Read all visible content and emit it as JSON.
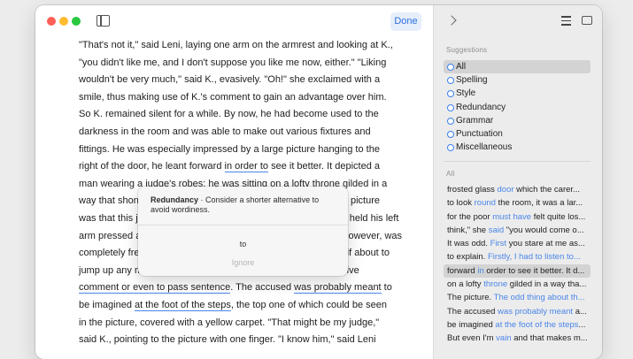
{
  "toolbar": {
    "done_label": "Done"
  },
  "document": {
    "lines": [
      [
        {
          "t": "\"That's not it,\" said Leni, laying one arm on the armrest and looking at K.,"
        }
      ],
      [
        {
          "t": "\"you didn't like me, and I don't suppose you like me now, either.\" \"Liking"
        }
      ],
      [
        {
          "t": "wouldn't be very much,\" said K., evasively. \"Oh!\" she exclaimed with a"
        }
      ],
      [
        {
          "t": "smile, thus making use of K.'s comment to gain an advantage over him."
        }
      ],
      [
        {
          "t": "So K. remained silent for a while. By now, he had become used to the"
        }
      ],
      [
        {
          "t": "darkness in the room and was able to make out various fixtures and"
        }
      ],
      [
        {
          "t": "fittings. He was especially impressed by a large picture hanging to the"
        }
      ],
      [
        {
          "t": "right of the door, he leant forward "
        },
        {
          "t": "in order to",
          "u": "sel"
        },
        {
          "t": " see it better. It depicted a"
        }
      ],
      [
        {
          "t": "man wearing a judge's robes; he was sitting on a lofty throne gilded in a"
        }
      ],
      [
        {
          "t": "way that shone out of the picture. What was unusual about the picture"
        }
      ],
      [
        {
          "t": "was that this judge was not sitting there in dignified repose; he held his left"
        }
      ],
      [
        {
          "t": "arm pressed against the back and the armrest, the right arm, however, was"
        }
      ],
      [
        {
          "t": "completely free and gripped only the armrest with its hand, as if about to"
        }
      ],
      [
        {
          "t": "jump up any moment in a violent outburst and to make a decisive"
        }
      ],
      [
        {
          "t": "comment or even to pass sentence",
          "u": "u"
        },
        {
          "t": ". The accused "
        },
        {
          "t": "was probably meant",
          "u": "u"
        },
        {
          "t": " to"
        }
      ],
      [
        {
          "t": "be imagined "
        },
        {
          "t": "at the foot of the steps",
          "u": "u"
        },
        {
          "t": ", the top one of which could be seen"
        }
      ],
      [
        {
          "t": "in the picture, covered with a yellow carpet. \"That might be my judge,\""
        }
      ],
      [
        {
          "t": "said K., pointing to the picture with one finger. \"I know him,\" said Leni"
        }
      ]
    ]
  },
  "popover": {
    "title": "Redundancy",
    "description": " · Consider a shorter alternative to avoid wordiness.",
    "suggestion": "to",
    "ignore_label": "Ignore"
  },
  "sidebar": {
    "suggestions_heading": "Suggestions",
    "categories": [
      "All",
      "Spelling",
      "Style",
      "Redundancy",
      "Grammar",
      "Punctuation",
      "Miscellaneous"
    ],
    "results_heading": "All",
    "results": [
      [
        {
          "t": "frosted glass "
        },
        {
          "t": "door",
          "h": true
        },
        {
          "t": " which the carer..."
        }
      ],
      [
        {
          "t": "to look "
        },
        {
          "t": "round",
          "h": true
        },
        {
          "t": " the room, it was a lar..."
        }
      ],
      [
        {
          "t": "for the poor "
        },
        {
          "t": "must have",
          "h": true
        },
        {
          "t": " felt quite los..."
        }
      ],
      [
        {
          "t": "think,\" she "
        },
        {
          "t": "said",
          "h": true
        },
        {
          "t": " \"you would come o..."
        }
      ],
      [
        {
          "t": "It was odd. "
        },
        {
          "t": "First",
          "h": true
        },
        {
          "t": " you stare at me as..."
        }
      ],
      [
        {
          "t": "to explain. "
        },
        {
          "t": "Firstly, I had to listen to...",
          "h": true
        }
      ],
      [
        {
          "t": "forward "
        },
        {
          "t": "in",
          "h": true
        },
        {
          "t": " order to see it better. It d..."
        }
      ],
      [
        {
          "t": "on a lofty "
        },
        {
          "t": "throne",
          "h": true
        },
        {
          "t": " gilded in a way tha..."
        }
      ],
      [
        {
          "t": "The picture. "
        },
        {
          "t": "The odd thing about th...",
          "h": true
        }
      ],
      [
        {
          "t": "The accused "
        },
        {
          "t": "was probably meant",
          "h": true
        },
        {
          "t": " a..."
        }
      ],
      [
        {
          "t": "be imagined "
        },
        {
          "t": "at the foot of the steps",
          "h": true
        },
        {
          "t": "..."
        }
      ],
      [
        {
          "t": "But even I'm "
        },
        {
          "t": "vain",
          "h": true
        },
        {
          "t": " and that makes m..."
        }
      ]
    ]
  },
  "colors": {
    "accent": "#4a86e8",
    "done_button_bg": "#e6eefb",
    "sidebar_bg": "#ececec"
  }
}
